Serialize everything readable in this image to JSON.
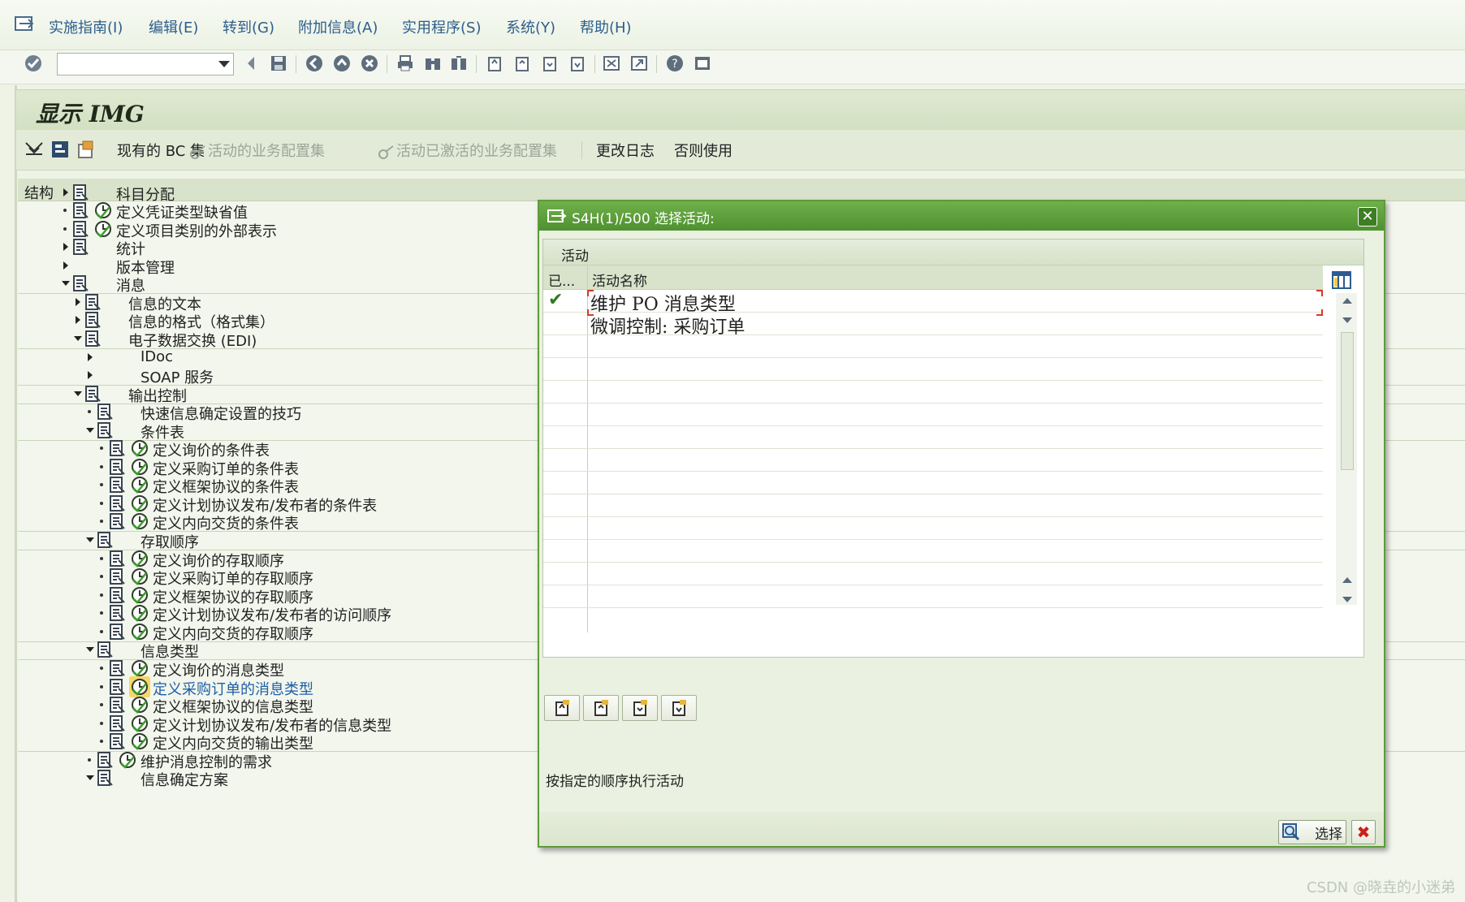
{
  "menubar": {
    "items": [
      "实施指南(I)",
      "编辑(E)",
      "转到(G)",
      "附加信息(A)",
      "实用程序(S)",
      "系统(Y)",
      "帮助(H)"
    ]
  },
  "toolbar": {
    "command_field": "",
    "icons": [
      "enter-icon",
      "back-icon",
      "save-icon",
      "back-green-icon",
      "exit-icon",
      "cancel-icon",
      "print-icon",
      "find-icon",
      "find-next-icon",
      "first-page-icon",
      "prev-page-icon",
      "next-page-icon",
      "last-page-icon",
      "new-session-icon",
      "shortcut-icon",
      "help-icon",
      "layout-icon"
    ]
  },
  "title": "显示 IMG",
  "app_toolbar": {
    "bc_sets": "现有的 BC 集",
    "active_bc_sets": "活动的业务配置集",
    "activated_bc_sets": "活动已激活的业务配置集",
    "change_log": "更改日志",
    "usage": "否则使用"
  },
  "structure": {
    "header": "结构",
    "rows": [
      {
        "text": "科目分配",
        "clock": false,
        "selected": false
      },
      {
        "text": "定义凭证类型缺省值",
        "clock": true,
        "selected": false
      },
      {
        "text": "定义项目类别的外部表示",
        "clock": true,
        "selected": false
      },
      {
        "text": "统计",
        "clock": false,
        "selected": false
      },
      {
        "text": "版本管理",
        "clock": false,
        "selected": false
      },
      {
        "text": "消息",
        "clock": false,
        "selected": false
      },
      {
        "text": "信息的文本",
        "clock": false,
        "selected": false
      },
      {
        "text": "信息的格式（格式集）",
        "clock": false,
        "selected": false
      },
      {
        "text": "电子数据交换 (EDI)",
        "clock": false,
        "selected": false
      },
      {
        "text": "IDoc",
        "clock": false,
        "selected": false
      },
      {
        "text": "SOAP 服务",
        "clock": false,
        "selected": false
      },
      {
        "text": "输出控制",
        "clock": false,
        "selected": false
      },
      {
        "text": "快速信息确定设置的技巧",
        "clock": false,
        "selected": false
      },
      {
        "text": "条件表",
        "clock": false,
        "selected": false
      },
      {
        "text": "定义询价的条件表",
        "clock": true,
        "selected": false
      },
      {
        "text": "定义采购订单的条件表",
        "clock": true,
        "selected": false
      },
      {
        "text": "定义框架协议的条件表",
        "clock": true,
        "selected": false
      },
      {
        "text": "定义计划协议发布/发布者的条件表",
        "clock": true,
        "selected": false
      },
      {
        "text": "定义内向交货的条件表",
        "clock": true,
        "selected": false
      },
      {
        "text": "存取顺序",
        "clock": false,
        "selected": false
      },
      {
        "text": "定义询价的存取顺序",
        "clock": true,
        "selected": false
      },
      {
        "text": "定义采购订单的存取顺序",
        "clock": true,
        "selected": false
      },
      {
        "text": "定义框架协议的存取顺序",
        "clock": true,
        "selected": false
      },
      {
        "text": "定义计划协议发布/发布者的访问顺序",
        "clock": true,
        "selected": false
      },
      {
        "text": "定义内向交货的存取顺序",
        "clock": true,
        "selected": false
      },
      {
        "text": "信息类型",
        "clock": false,
        "selected": false
      },
      {
        "text": "定义询价的消息类型",
        "clock": true,
        "selected": false
      },
      {
        "text": "定义采购订单的消息类型",
        "clock": true,
        "selected": true
      },
      {
        "text": "定义框架协议的信息类型",
        "clock": true,
        "selected": false
      },
      {
        "text": "定义计划协议发布/发布者的信息类型",
        "clock": true,
        "selected": false
      },
      {
        "text": "定义内向交货的输出类型",
        "clock": true,
        "selected": false
      },
      {
        "text": "维护消息控制的需求",
        "clock": true,
        "selected": false
      },
      {
        "text": "信息确定方案",
        "clock": false,
        "selected": false
      }
    ]
  },
  "dialog": {
    "title": "S4H(1)/500 选择活动:",
    "table_title": "活动",
    "columns": [
      "已...",
      "活动名称"
    ],
    "rows": [
      {
        "done": true,
        "name": "维护 PO 消息类型"
      },
      {
        "done": false,
        "name": "微调控制: 采购订单"
      }
    ],
    "note": "按指定的顺序执行活动",
    "select_label": "选择"
  },
  "watermark": "CSDN @晓垚的小迷弟"
}
